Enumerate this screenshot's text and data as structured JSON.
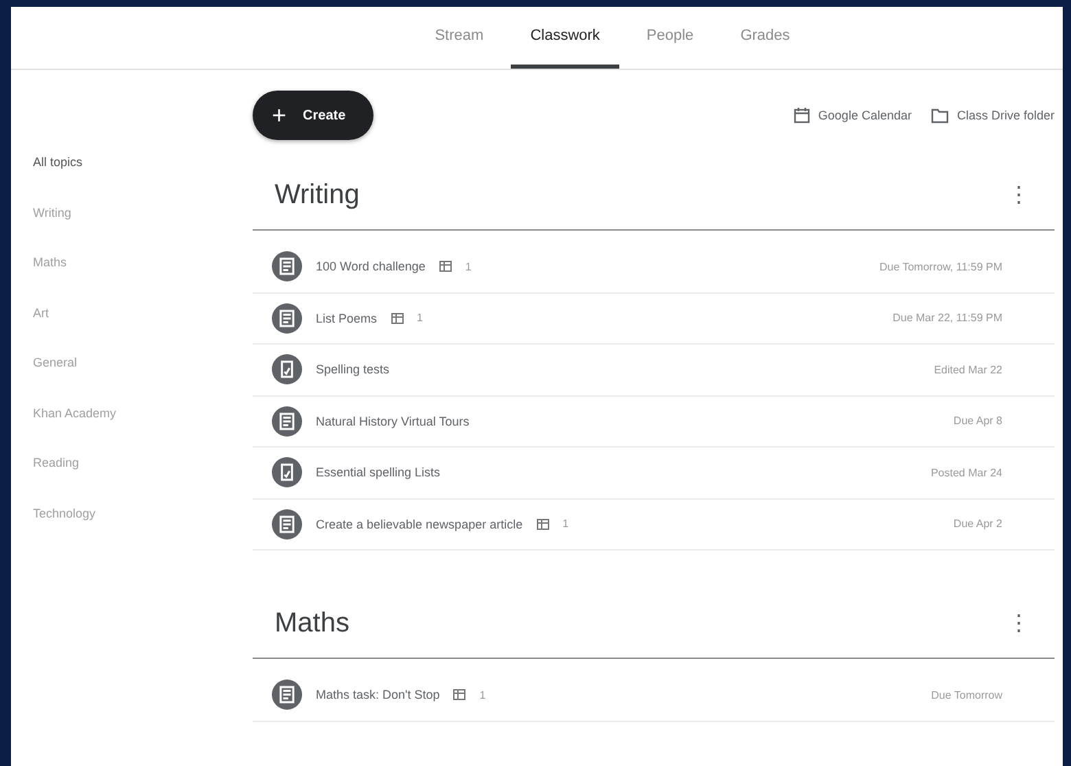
{
  "tabs": [
    {
      "label": "Stream",
      "selected": false
    },
    {
      "label": "Classwork",
      "selected": true
    },
    {
      "label": "People",
      "selected": false
    },
    {
      "label": "Grades",
      "selected": false
    }
  ],
  "create_button": {
    "icon": "+",
    "label": "Create"
  },
  "links": [
    "Google Calendar",
    "Class Drive folder"
  ],
  "sidebar": {
    "items": [
      {
        "label": "All topics",
        "selected": true
      },
      {
        "label": "Writing",
        "selected": false
      },
      {
        "label": "Maths",
        "selected": false
      },
      {
        "label": "Art",
        "selected": false
      },
      {
        "label": "General",
        "selected": false
      },
      {
        "label": "Khan Academy",
        "selected": false
      },
      {
        "label": "Reading",
        "selected": false
      },
      {
        "label": "Technology",
        "selected": false
      }
    ]
  },
  "topics": [
    {
      "title": "Writing",
      "menu": "⋮",
      "items": [
        {
          "kind": "assignment",
          "title": "100 Word challenge",
          "attachments": "1",
          "meta": "Due Tomorrow, 11:59 PM"
        },
        {
          "kind": "assignment",
          "title": "List Poems",
          "attachments": "1",
          "meta": "Due Mar 22, 11:59 PM"
        },
        {
          "kind": "material",
          "title": "Spelling tests",
          "meta": "Edited Mar 22"
        },
        {
          "kind": "assignment",
          "title": "Natural History Virtual Tours",
          "meta": "Due Apr 8"
        },
        {
          "kind": "material",
          "title": "Essential spelling Lists",
          "meta": "Posted Mar 24"
        },
        {
          "kind": "assignment",
          "title": "Create a believable newspaper article",
          "attachments": "1",
          "meta": "Due Apr 2"
        }
      ]
    },
    {
      "title": "Maths",
      "menu": "⋮",
      "items": [
        {
          "kind": "assignment",
          "title": "Maths task: Don't Stop",
          "attachments": "1",
          "meta": "Due Tomorrow"
        }
      ]
    }
  ]
}
